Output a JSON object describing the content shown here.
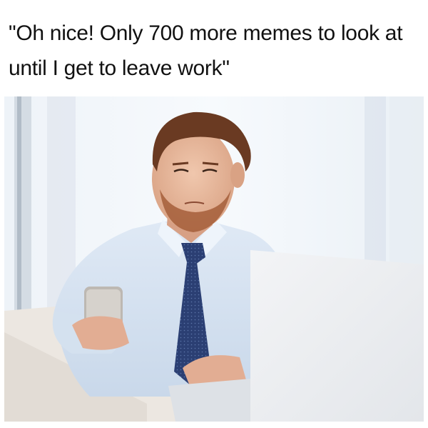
{
  "caption": "\"Oh nice! Only 700 more memes to look at until I get to leave work\"",
  "photo": {
    "subject": "man in blue shirt and navy tie looking at smartphone at desk with laptop",
    "colors": {
      "shirt": "#d9e6f3",
      "tie": "#2b3f73",
      "hair": "#6a3a22",
      "skin": "#e8b79c",
      "background": "#f4f8fc"
    }
  }
}
